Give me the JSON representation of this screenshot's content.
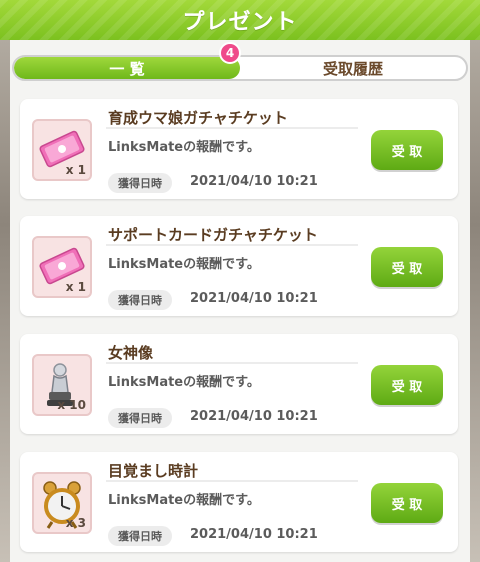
{
  "header": {
    "title": "プレゼント"
  },
  "tabs": [
    {
      "label": "一 覧",
      "active": true
    },
    {
      "label": "受取履歴",
      "active": false
    }
  ],
  "badge": {
    "count": "4"
  },
  "items": [
    {
      "name": "育成ウマ娘ガチャチケット",
      "description": "LinksMateの報酬です。",
      "date_label": "獲得日時",
      "date": "2021/04/10 10:21",
      "quantity": "x 1",
      "icon": "pink-ticket-icon",
      "button_label": "受 取"
    },
    {
      "name": "サポートカードガチャチケット",
      "description": "LinksMateの報酬です。",
      "date_label": "獲得日時",
      "date": "2021/04/10 10:21",
      "quantity": "x 1",
      "icon": "pink-ticket-icon",
      "button_label": "受 取"
    },
    {
      "name": "女神像",
      "description": "LinksMateの報酬です。",
      "date_label": "獲得日時",
      "date": "2021/04/10 10:21",
      "quantity": "x 10",
      "icon": "goddess-statue-icon",
      "button_label": "受 取"
    },
    {
      "name": "目覚まし時計",
      "description": "LinksMateの報酬です。",
      "date_label": "獲得日時",
      "date": "2021/04/10 10:21",
      "quantity": "x 3",
      "icon": "alarm-clock-icon",
      "button_label": "受 取"
    }
  ],
  "colors": {
    "accent_green": "#7cc11f",
    "badge_pink": "#ef4a8a",
    "title_brown": "#5a3c21"
  }
}
